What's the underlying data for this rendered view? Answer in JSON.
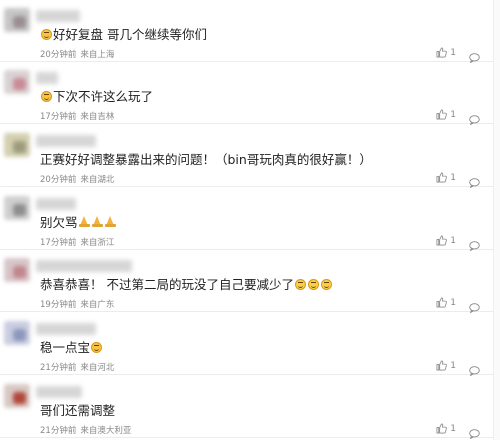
{
  "comments": [
    {
      "text": "好好复盘 哥几个继续等你们",
      "time": "20分钟前",
      "location": "来自上海",
      "likes": "1",
      "leading_emoji": "smile",
      "trailing_emoji": "",
      "avatar_colors": [
        "#c6c6c6",
        "#9a8e93"
      ]
    },
    {
      "text": "下次不许这么玩了",
      "time": "17分钟前",
      "location": "来自吉林",
      "likes": "1",
      "leading_emoji": "smile",
      "trailing_emoji": "",
      "avatar_colors": [
        "#d9d1d3",
        "#c98b96"
      ]
    },
    {
      "text": "正赛好好调整暴露出来的问题！（bin哥玩肉真的很好赢！）",
      "time": "20分钟前",
      "location": "来自湖北",
      "likes": "1",
      "leading_emoji": "",
      "trailing_emoji": "",
      "avatar_colors": [
        "#d3cfb0",
        "#9c9c7c"
      ]
    },
    {
      "text": "别欠骂",
      "time": "17分钟前",
      "location": "来自浙江",
      "likes": "1",
      "leading_emoji": "",
      "trailing_emoji": "pray-pray-pray",
      "avatar_colors": [
        "#cfcfcf",
        "#8e8e8e"
      ]
    },
    {
      "text": "恭喜恭喜！ 不过第二局的玩没了自己要减少了",
      "time": "19分钟前",
      "location": "来自广东",
      "likes": "1",
      "leading_emoji": "",
      "trailing_emoji": "laugh-laugh-laugh",
      "avatar_colors": [
        "#d7c5c8",
        "#c1868e"
      ]
    },
    {
      "text": "稳一点宝",
      "time": "21分钟前",
      "location": "来自河北",
      "likes": "1",
      "leading_emoji": "",
      "trailing_emoji": "smile",
      "avatar_colors": [
        "#c9cde0",
        "#8d97bd"
      ]
    },
    {
      "text": "哥们还需调整",
      "time": "21分钟前",
      "location": "来自澳大利亚",
      "likes": "1",
      "leading_emoji": "",
      "trailing_emoji": "",
      "avatar_colors": [
        "#d8c8c3",
        "#b2463a"
      ]
    }
  ],
  "colors": {
    "text": "#222222",
    "meta": "#888888",
    "divider": "#ececec"
  }
}
